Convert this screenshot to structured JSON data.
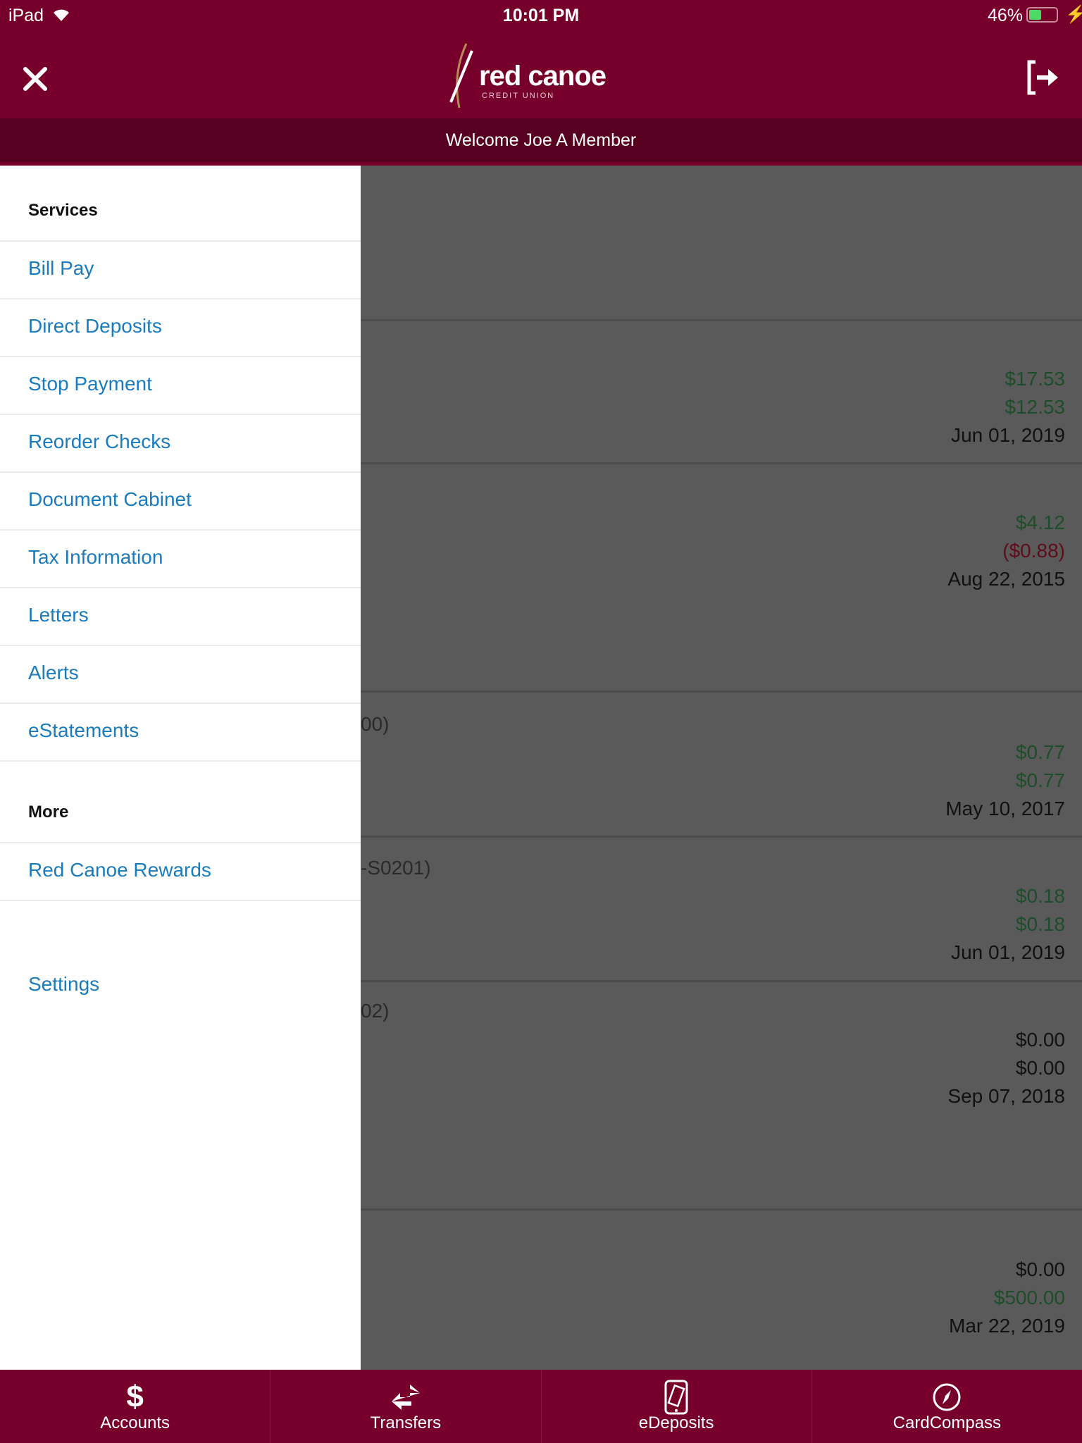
{
  "status": {
    "device": "iPad",
    "time": "10:01 PM",
    "battery": "46%",
    "battery_level": 0.46
  },
  "header": {
    "logo_text": "red canoe",
    "logo_sub": "CREDIT UNION",
    "close_icon": "close-icon",
    "logout_icon": "logout-icon"
  },
  "welcome": "Welcome Joe A Member",
  "sidebar": {
    "services_heading": "Services",
    "services": [
      "Bill Pay",
      "Direct Deposits",
      "Stop Payment",
      "Reorder Checks",
      "Document Cabinet",
      "Tax Information",
      "Letters",
      "Alerts",
      "eStatements"
    ],
    "more_heading": "More",
    "more": [
      "Red Canoe Rewards"
    ],
    "settings": "Settings"
  },
  "accounts": [
    {
      "label": "",
      "lines": []
    },
    {
      "label": "",
      "lines": [
        {
          "text": "$17.53",
          "tone": "positive"
        },
        {
          "text": "$12.53",
          "tone": "positive"
        },
        {
          "text": "Jun 01, 2019",
          "tone": "date"
        }
      ]
    },
    {
      "label": "",
      "lines": [
        {
          "text": "$4.12",
          "tone": "positive"
        },
        {
          "text": "($0.88)",
          "tone": "negative"
        },
        {
          "text": "Aug 22, 2015",
          "tone": "date"
        }
      ]
    },
    {
      "label": "00)",
      "lines": [
        {
          "text": "$0.77",
          "tone": "positive"
        },
        {
          "text": "$0.77",
          "tone": "positive"
        },
        {
          "text": "May 10, 2017",
          "tone": "date"
        }
      ]
    },
    {
      "label": "-S0201)",
      "lines": [
        {
          "text": "$0.18",
          "tone": "positive"
        },
        {
          "text": "$0.18",
          "tone": "positive"
        },
        {
          "text": "Jun 01, 2019",
          "tone": "date"
        }
      ]
    },
    {
      "label": "02)",
      "lines": [
        {
          "text": "$0.00",
          "tone": "neutral"
        },
        {
          "text": "$0.00",
          "tone": "neutral"
        },
        {
          "text": "Sep 07, 2018",
          "tone": "date"
        }
      ]
    },
    {
      "label": "",
      "lines": [
        {
          "text": "$0.00",
          "tone": "neutral"
        },
        {
          "text": "$500.00",
          "tone": "positive"
        },
        {
          "text": "Mar 22, 2019",
          "tone": "date"
        }
      ]
    }
  ],
  "colors": {
    "brand": "#77002b",
    "brand_dark": "#58001f",
    "link": "#1a7bbf",
    "positive": "#1e4d2b",
    "negative": "#5e0d1a"
  },
  "tabs": [
    {
      "label": "Accounts",
      "icon": "dollar-icon"
    },
    {
      "label": "Transfers",
      "icon": "transfer-icon"
    },
    {
      "label": "eDeposits",
      "icon": "mobile-deposit-icon"
    },
    {
      "label": "CardCompass",
      "icon": "compass-icon"
    }
  ]
}
